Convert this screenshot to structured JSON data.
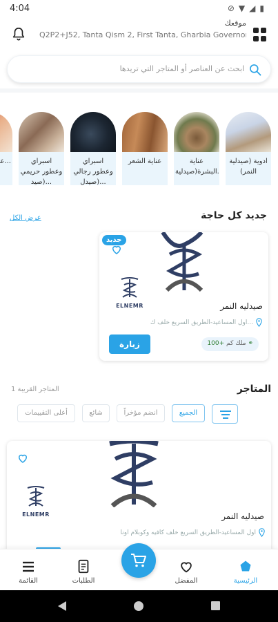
{
  "status_bar": {
    "time": "4:04"
  },
  "header": {
    "location_title": "موقعك",
    "location_address": "Q2P2+J52, Tanta Qism 2, First Tanta, Gharbia Governorate..."
  },
  "search": {
    "placeholder": "ابحث عن العناصر أو المتاجر التي تريدها"
  },
  "categories": [
    {
      "label": "ادوية (صيدلية النمر)"
    },
    {
      "label": "عناية البشرة(صيدلية..."
    },
    {
      "label": "عناية الشعر"
    },
    {
      "label": "اسبراي وعطور رجالي (صيدل..."
    },
    {
      "label": "اسبراي وعطور حريمي (صيد..."
    },
    {
      "label": "عنا حر..."
    }
  ],
  "new_section": {
    "title": "جديد كل حاجة",
    "view_all": "عرض الكل",
    "card": {
      "badge": "جديد",
      "logo_text": "ELNEMR",
      "name": "صيدليه النمر",
      "address": "اول المساعيد-الطريق السريع خلف ك...",
      "distance_value": "+100",
      "distance_unit": "كم",
      "distance_suffix": "ملك",
      "visit_button": "زيارة"
    }
  },
  "stores_section": {
    "title": "المتاجر",
    "count": "1 المتاجر القريبة",
    "filters": [
      "الجميع",
      "انضم مؤخراً",
      "شائع",
      "أعلى التقييمات"
    ],
    "card": {
      "logo_text": "ELNEMR",
      "name": "صيدليه النمر",
      "address": "اول المساعيد-الطريق السريع خلف كافيه وكوبلام اونا"
    }
  },
  "bottom_nav": {
    "items": [
      {
        "label": "الرئيسية",
        "icon": "home-icon"
      },
      {
        "label": "المفضل",
        "icon": "heart-icon"
      },
      {
        "label": "الطلبات",
        "icon": "orders-icon"
      },
      {
        "label": "القائمة",
        "icon": "menu-icon"
      }
    ],
    "cart_icon": "cart-icon"
  },
  "colors": {
    "accent": "#2aa3e6",
    "logo_dark": "#2f3e64",
    "category_bg": "#eaf5fc"
  }
}
